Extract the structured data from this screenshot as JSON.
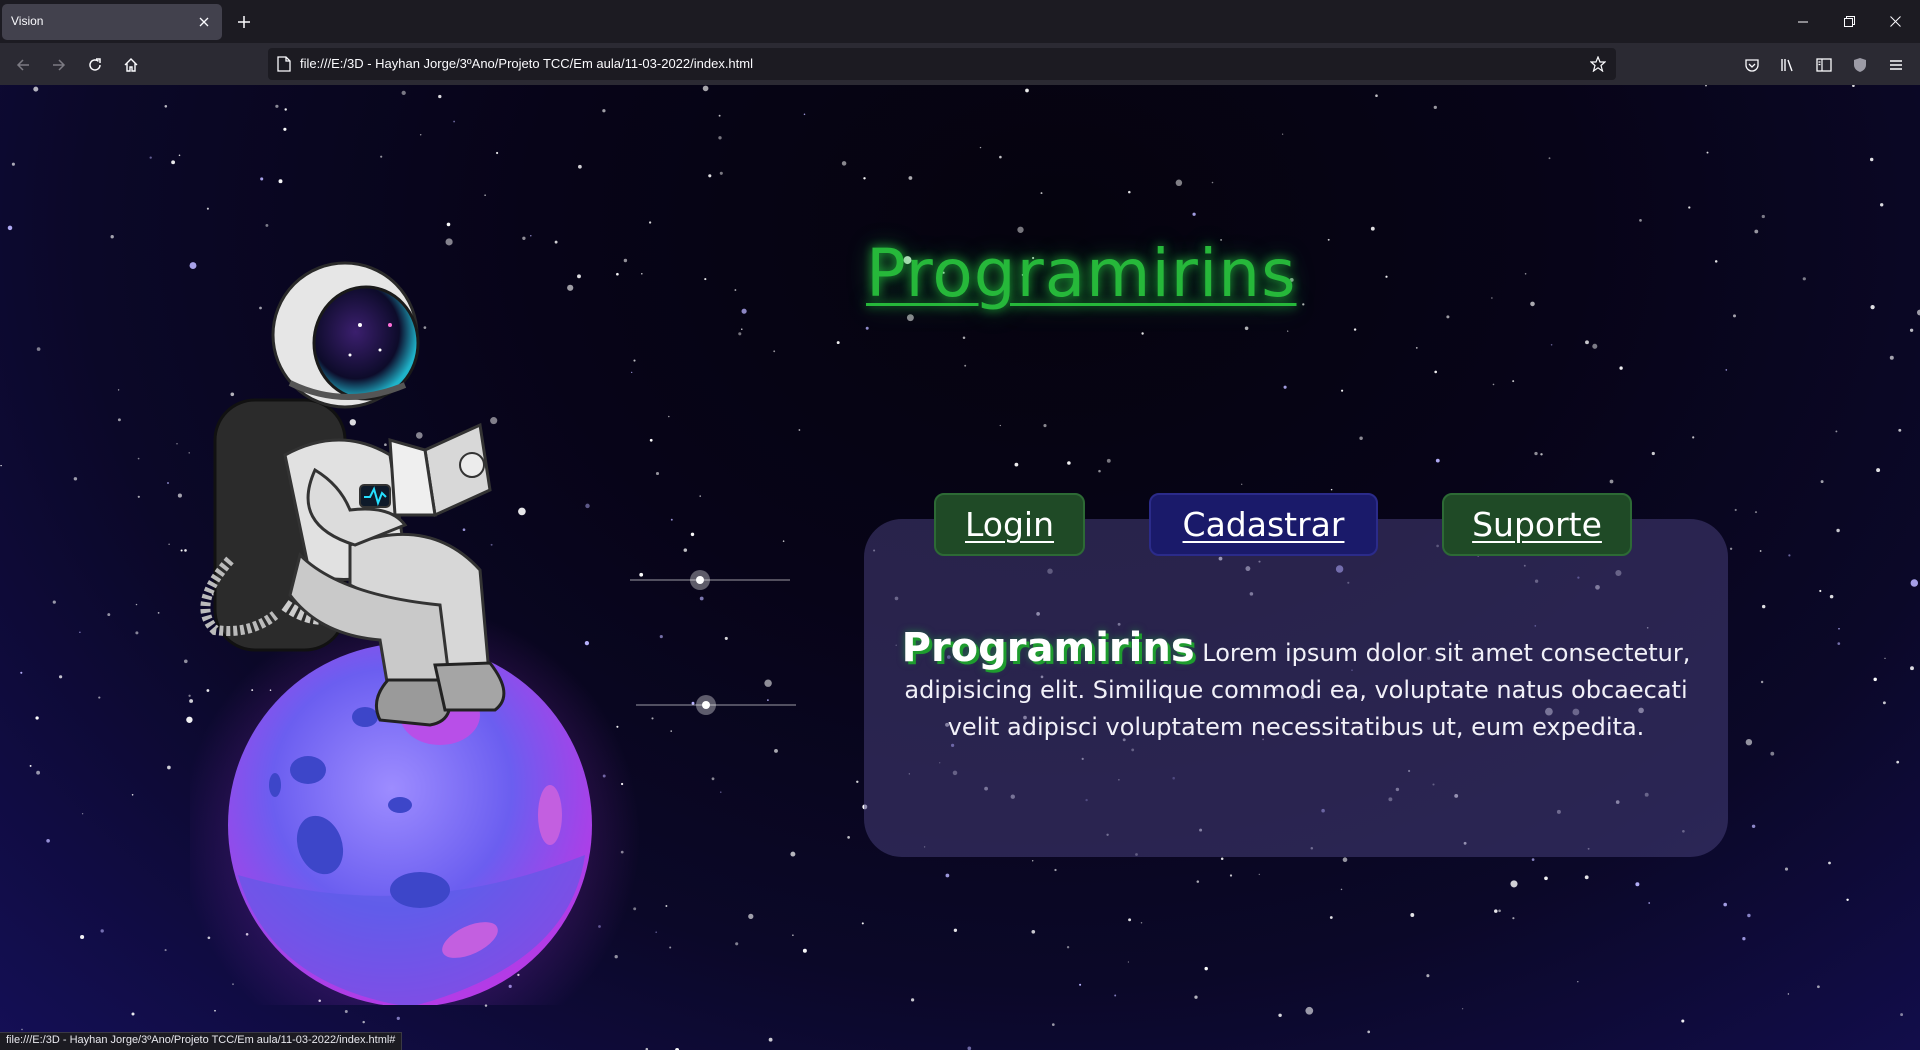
{
  "browser": {
    "tab_title": "Vision",
    "url": "file:///E:/3D - Hayhan Jorge/3ºAno/Projeto TCC/Em aula/11-03-2022/index.html",
    "status_url": "file:///E:/3D - Hayhan Jorge/3ºAno/Projeto TCC/Em aula/11-03-2022/index.html#"
  },
  "page": {
    "heading": "Programirins",
    "buttons": {
      "login": "Login",
      "cadastrar": "Cadastrar",
      "suporte": "Suporte"
    },
    "card": {
      "brand": "Programirins",
      "text": " Lorem ipsum dolor sit amet consectetur, adipisicing elit. Similique commodi ea, voluptate natus obcaecati velit adipisci voluptatem necessitatibus ut, eum expedita."
    }
  },
  "colors": {
    "heading": "#26b83a",
    "button_green": "#1f4a26",
    "button_blue": "#1a1a6a",
    "card": "#463e78",
    "background_top": "#05030e",
    "background_bottom": "#140f56"
  },
  "icons": [
    "close-icon",
    "plus-icon",
    "minimize-icon",
    "restore-icon",
    "window-close-icon",
    "back-icon",
    "forward-icon",
    "reload-icon",
    "home-icon",
    "page-icon",
    "bookmark-star-icon",
    "pocket-icon",
    "library-icon",
    "sidebar-icon",
    "shield-icon",
    "menu-icon"
  ]
}
